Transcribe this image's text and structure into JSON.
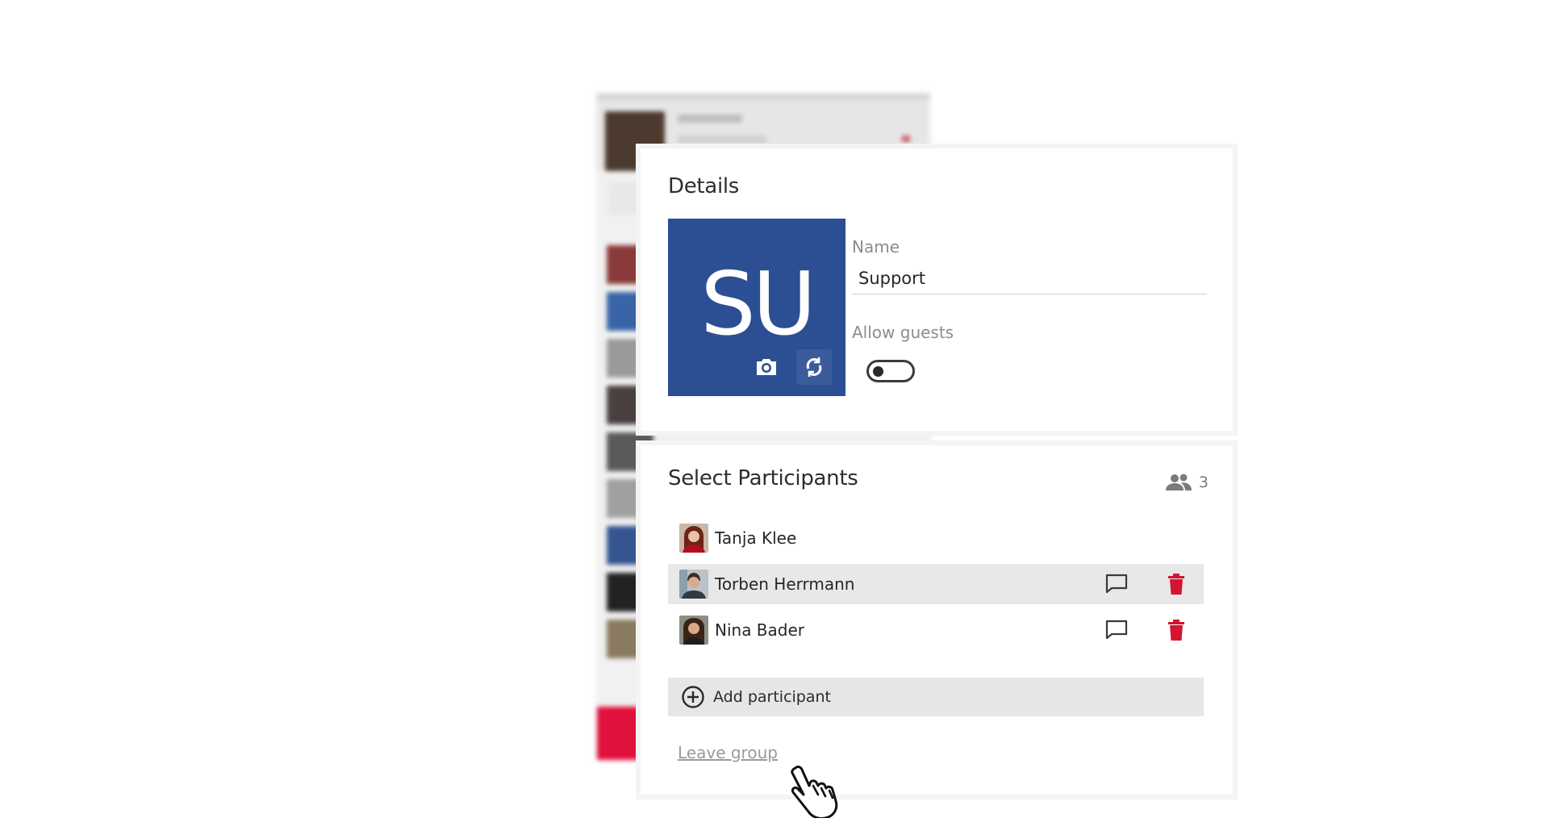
{
  "details": {
    "title": "Details",
    "group_initials": "SU",
    "avatar_color": "#2c4e93",
    "avatar_icons": [
      "camera-icon",
      "refresh-icon"
    ],
    "name_label": "Name",
    "name_value": "Support",
    "allow_guests_label": "Allow guests",
    "allow_guests_enabled": false
  },
  "participants": {
    "title": "Select Participants",
    "count": "3",
    "count_icon": "people-icon",
    "list": [
      {
        "name": "Tanja Klee",
        "highlighted": false,
        "show_actions": false
      },
      {
        "name": "Torben Herrmann",
        "highlighted": true,
        "show_actions": true
      },
      {
        "name": "Nina Bader",
        "highlighted": false,
        "show_actions": true
      }
    ],
    "add_label": "Add participant",
    "leave_label": "Leave group"
  },
  "colors": {
    "accent_red": "#e0113c",
    "delete_red": "#d5142f"
  }
}
